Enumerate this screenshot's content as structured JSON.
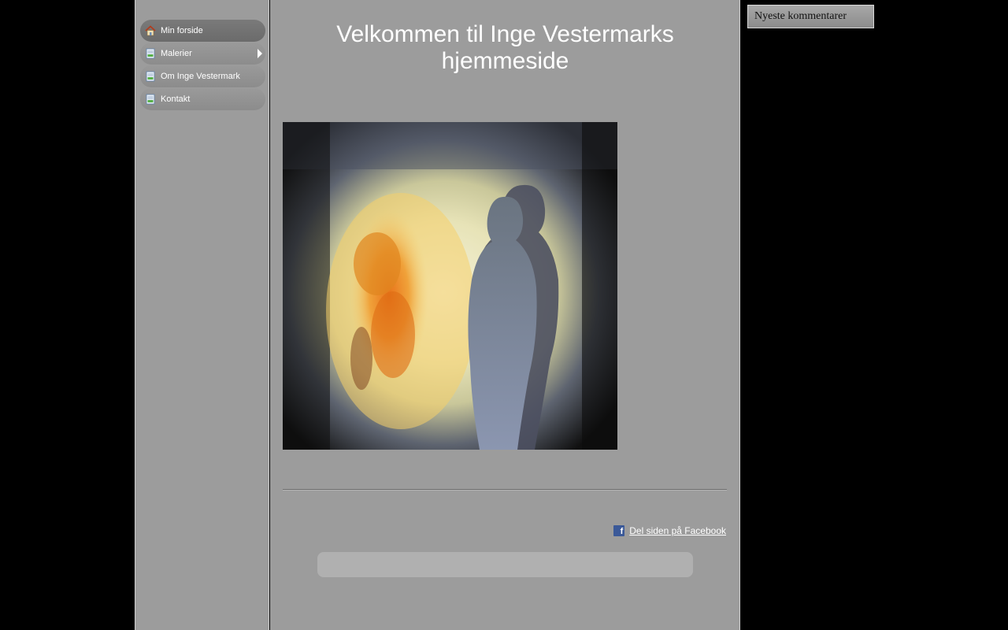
{
  "nav": {
    "items": [
      {
        "label": "Min forside",
        "icon": "home-icon",
        "active": true
      },
      {
        "label": "Malerier",
        "icon": "page-icon",
        "has_submenu": true
      },
      {
        "label": "Om Inge Vestermark",
        "icon": "page-icon"
      },
      {
        "label": "Kontakt",
        "icon": "page-icon"
      }
    ]
  },
  "main": {
    "title_line1": "Velkommen til Inge Vestermarks",
    "title_line2": "hjemmeside",
    "facebook_share": "Del siden på Facebook"
  },
  "sidebar_right": {
    "comments_title": "Nyeste kommentarer"
  },
  "colors": {
    "background": "#000000",
    "panel": "#9c9c9c",
    "facebook": "#3b5998"
  }
}
